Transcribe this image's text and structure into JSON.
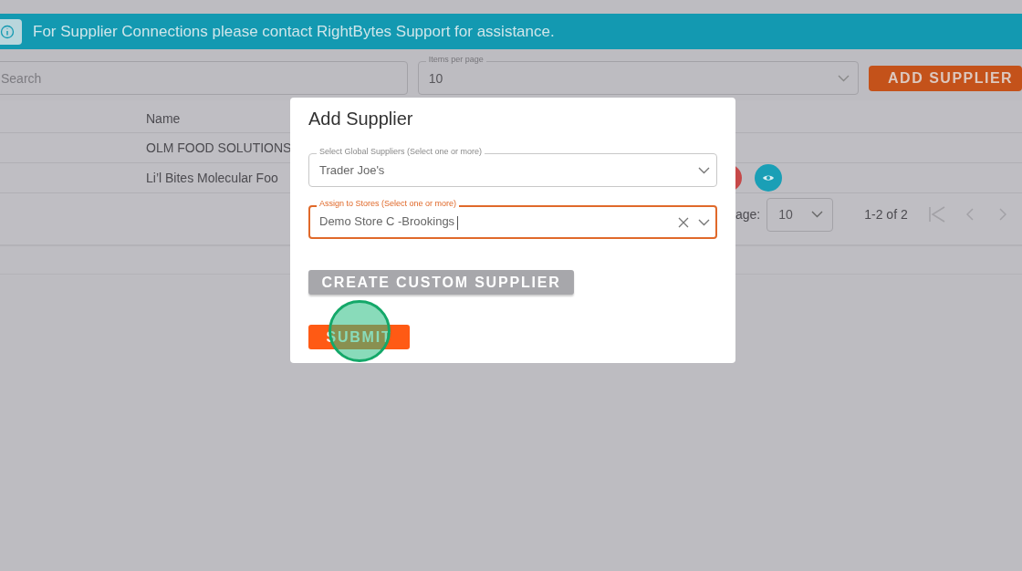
{
  "banner": {
    "text": "For Supplier Connections please contact RightBytes Support for assistance."
  },
  "search": {
    "placeholder": "Search"
  },
  "items_per_page": {
    "label": "Items per page",
    "value": "10"
  },
  "add_button": {
    "label": "ADD SUPPLIER"
  },
  "table": {
    "columns": [
      "Name"
    ],
    "rows": [
      {
        "name": "OLM FOOD SOLUTIONS",
        "actions": false
      },
      {
        "name": "Li’l Bites Molecular Foo",
        "actions": true
      }
    ]
  },
  "pagination": {
    "label": "age:",
    "value": "10",
    "range": "1-2 of 2"
  },
  "dialog": {
    "title": "Add Supplier",
    "fields": [
      {
        "label": "Select Global Suppliers (Select one or more)",
        "value": "Trader Joe's",
        "focused": false,
        "clearable": false
      },
      {
        "label": "Assign to Stores (Select one or more)",
        "value": "Demo Store C -Brookings",
        "focused": true,
        "clearable": true
      }
    ],
    "buttons": [
      {
        "label": "CREATE CUSTOM SUPPLIER",
        "kind": "secondary"
      },
      {
        "label": "SUBMIT",
        "kind": "primary"
      }
    ]
  }
}
